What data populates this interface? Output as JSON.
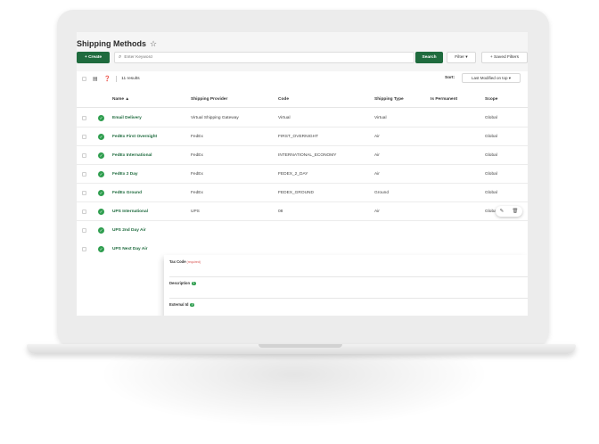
{
  "header": {
    "title": "Shipping Methods"
  },
  "toolbar": {
    "create_label": "+ Create",
    "search_placeholder": "Enter Keyword",
    "search_label": "Search",
    "filter_label": "Filter ▾",
    "saved_filters_label": "+ Saved Filters"
  },
  "summary": {
    "results_text": "11 results",
    "sort_label": "Sort:",
    "sort_value": "Last Modified on top ▾"
  },
  "columns": [
    "Name ▲",
    "Shipping Provider",
    "Code",
    "Shipping Type",
    "Is Permanent",
    "Scope"
  ],
  "rows": [
    {
      "name": "Email Delivery",
      "provider": "Virtual Shipping Gateway",
      "code": "Virtual",
      "type": "Virtual",
      "permanent": "",
      "scope": "Global"
    },
    {
      "name": "FedEx First Overnight",
      "provider": "FedEx",
      "code": "FIRST_OVERNIGHT",
      "type": "Air",
      "permanent": "",
      "scope": "Global"
    },
    {
      "name": "FedEx International",
      "provider": "FedEx",
      "code": "INTERNATIONAL_ECONOMY",
      "type": "Air",
      "permanent": "",
      "scope": "Global"
    },
    {
      "name": "FedEx 2 Day",
      "provider": "FedEx",
      "code": "FEDEX_2_DAY",
      "type": "Air",
      "permanent": "",
      "scope": "Global"
    },
    {
      "name": "FedEx Ground",
      "provider": "FedEx",
      "code": "FEDEX_GROUND",
      "type": "Ground",
      "permanent": "",
      "scope": "Global"
    },
    {
      "name": "UPS International",
      "provider": "UPS",
      "code": "08",
      "type": "Air",
      "permanent": "",
      "scope": "Global"
    },
    {
      "name": "UPS 2nd Day Air",
      "provider": "",
      "code": "",
      "type": "",
      "permanent": "",
      "scope": ""
    },
    {
      "name": "UPS Next Day Air",
      "provider": "",
      "code": "",
      "type": "",
      "permanent": "",
      "scope": ""
    }
  ],
  "detail": {
    "tax_code_label": "Tax Code",
    "required_text": "(required)",
    "description_label": "Description",
    "external_id_label": "External Id"
  },
  "icons": {
    "star": "star-outline-icon",
    "check": "check-circle-icon",
    "edit": "pencil-icon",
    "delete": "trash-icon"
  },
  "colors": {
    "primary": "#1f6b3e",
    "success": "#2f9e4f",
    "required": "#d9534f"
  }
}
